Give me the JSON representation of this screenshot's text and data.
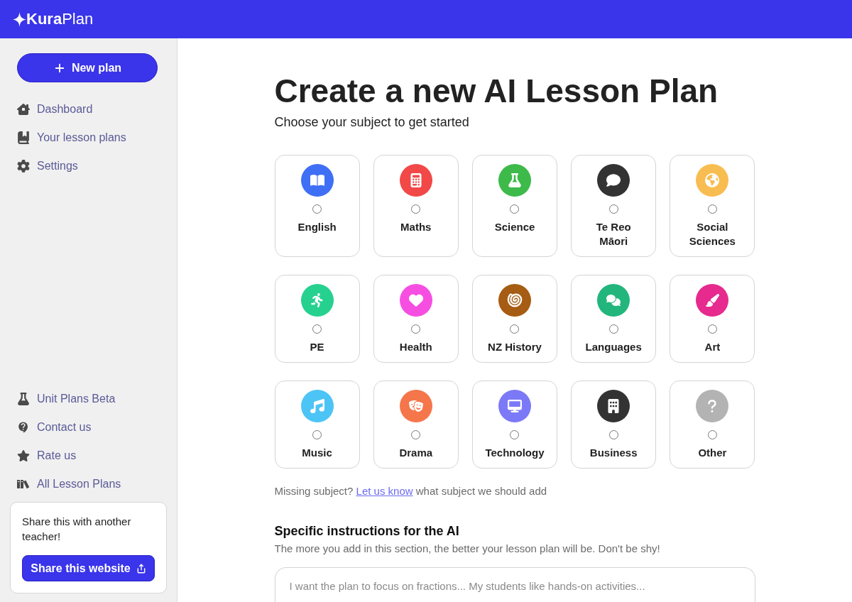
{
  "header": {
    "logo": "**Kura**Plan"
  },
  "sidebar": {
    "new_plan_button": "New plan",
    "nav_top": [
      {
        "label": "Dashboard"
      },
      {
        "label": "Your lesson plans"
      },
      {
        "label": "Settings"
      }
    ],
    "nav_bottom": [
      {
        "label": "Unit Plans Beta"
      },
      {
        "label": "Contact us"
      },
      {
        "label": "Rate us"
      },
      {
        "label": "All Lesson Plans"
      }
    ],
    "share_card": {
      "text": "Share this with another teacher!",
      "button": "Share this website"
    }
  },
  "main": {
    "title": "Create a new AI Lesson Plan",
    "subtitle": "Choose your subject to get started",
    "subjects": [
      {
        "label": "English",
        "color": "#3f6ff5",
        "selected": false
      },
      {
        "label": "Maths",
        "color": "#f24848",
        "selected": false
      },
      {
        "label": "Science",
        "color": "#3dba4a",
        "selected": false
      },
      {
        "label": "Te Reo Māori",
        "color": "#333333",
        "selected": false
      },
      {
        "label": "Social Sciences",
        "color": "#f8bd50",
        "selected": false
      },
      {
        "label": "PE",
        "color": "#26d18f",
        "selected": false
      },
      {
        "label": "Health",
        "color": "#f74ee2",
        "selected": false
      },
      {
        "label": "NZ History",
        "color": "#a65c12",
        "selected": false
      },
      {
        "label": "Languages",
        "color": "#22b67c",
        "selected": false
      },
      {
        "label": "Art",
        "color": "#e62a8e",
        "selected": false
      },
      {
        "label": "Music",
        "color": "#4cc4f6",
        "selected": false
      },
      {
        "label": "Drama",
        "color": "#f5764b",
        "selected": false
      },
      {
        "label": "Technology",
        "color": "#7b79f7",
        "selected": false
      },
      {
        "label": "Business",
        "color": "#333333",
        "selected": false
      },
      {
        "label": "Other",
        "color": "#b3b3b3",
        "selected": false
      }
    ],
    "missing_note": {
      "before": "Missing subject?",
      "link": "Let us know",
      "after": "what subject we should add"
    },
    "instructions": {
      "heading": "Specific instructions for the AI",
      "hint": "The more you add in this section, the better your lesson plan will be. Don't be shy!",
      "placeholder": "I want the plan to focus on fractions... My students like hands-on activities..."
    }
  }
}
